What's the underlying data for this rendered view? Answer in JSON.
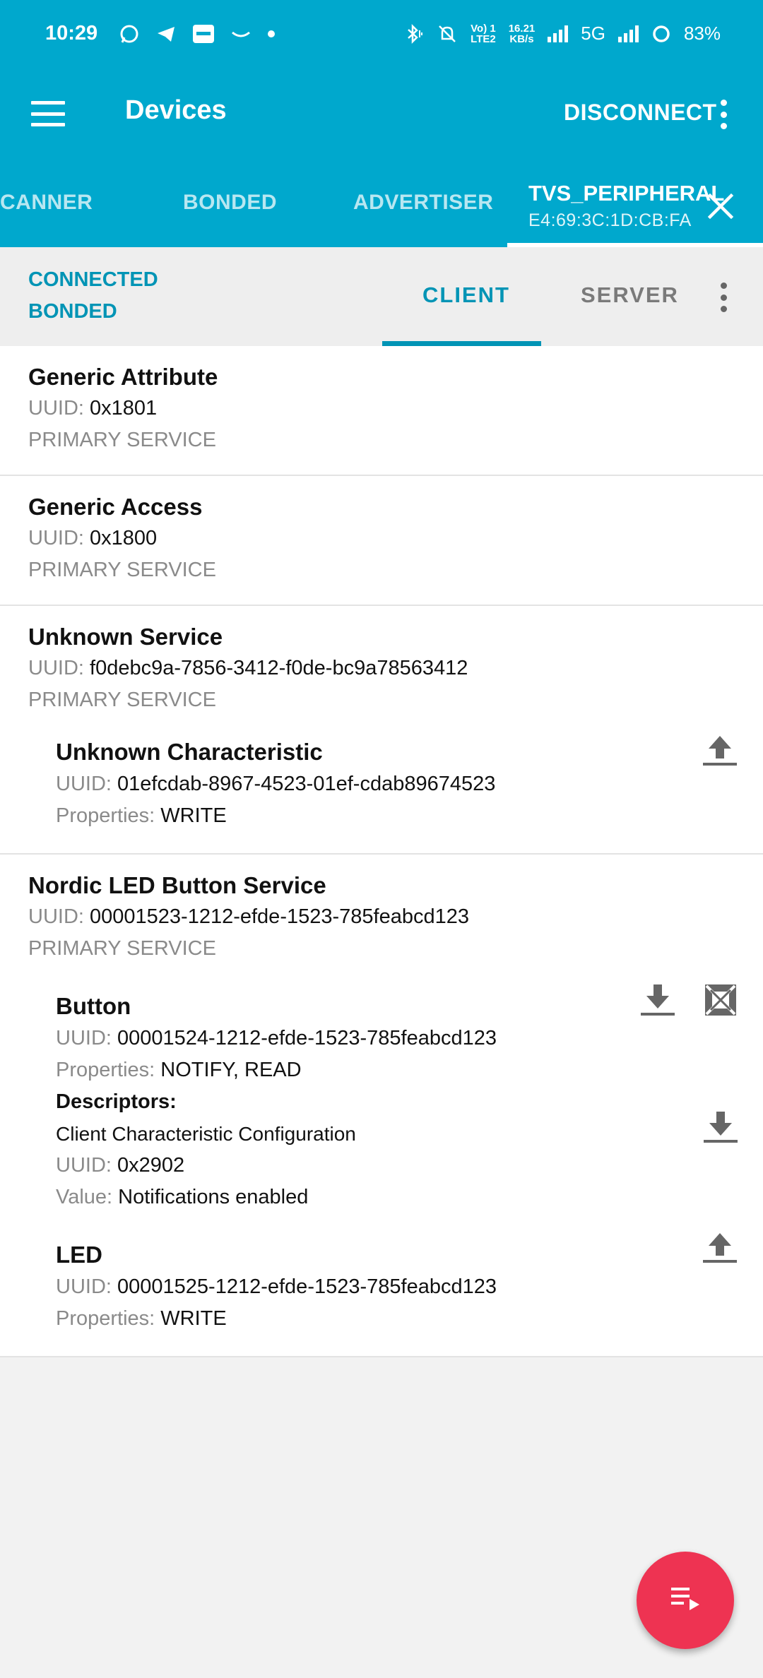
{
  "status_bar": {
    "time": "10:29",
    "volte_line1": "Vo) 1",
    "volte_line2": "LTE2",
    "speed_line1": "16.21",
    "speed_line2": "KB/s",
    "network": "5G",
    "battery": "83%"
  },
  "toolbar": {
    "title": "Devices",
    "disconnect_label": "DISCONNECT"
  },
  "device_tabs": {
    "scanner": "CANNER",
    "bonded": "BONDED",
    "advertiser": "ADVERTISER",
    "active_name": "TVS_PERIPHERAL",
    "active_mac": "E4:69:3C:1D:CB:FA"
  },
  "connection": {
    "status1": "CONNECTED",
    "status2": "BONDED",
    "tab_client": "CLIENT",
    "tab_server": "SERVER"
  },
  "labels": {
    "uuid": "UUID:",
    "properties": "Properties:",
    "value": "Value:",
    "descriptors": "Descriptors:"
  },
  "services": [
    {
      "name": "Generic Attribute",
      "uuid": "0x1801",
      "type": "PRIMARY SERVICE"
    },
    {
      "name": "Generic Access",
      "uuid": "0x1800",
      "type": "PRIMARY SERVICE"
    },
    {
      "name": "Unknown Service",
      "uuid": "f0debc9a-7856-3412-f0de-bc9a78563412",
      "type": "PRIMARY SERVICE",
      "characteristics": [
        {
          "name": "Unknown Characteristic",
          "uuid": "01efcdab-8967-4523-01ef-cdab89674523",
          "properties": "WRITE",
          "action_icon": "upload-icon"
        }
      ]
    },
    {
      "name": "Nordic LED Button Service",
      "uuid": "00001523-1212-efde-1523-785feabcd123",
      "type": "PRIMARY SERVICE",
      "characteristics": [
        {
          "name": "Button",
          "uuid": "00001524-1212-efde-1523-785feabcd123",
          "properties": "NOTIFY, READ",
          "action_icons": [
            "download-icon",
            "notifications-off-icon"
          ],
          "descriptor": {
            "name": "Client Characteristic Configuration",
            "uuid": "0x2902",
            "value": "Notifications enabled",
            "action_icon": "download-icon"
          }
        },
        {
          "name": "LED",
          "uuid": "00001525-1212-efde-1523-785feabcd123",
          "properties": "WRITE",
          "action_icon": "upload-icon"
        }
      ]
    }
  ],
  "colors": {
    "primary": "#00a8cd",
    "accent_text": "#0094b5",
    "fab": "#ee3352"
  },
  "fab_icon": "log-list-icon"
}
